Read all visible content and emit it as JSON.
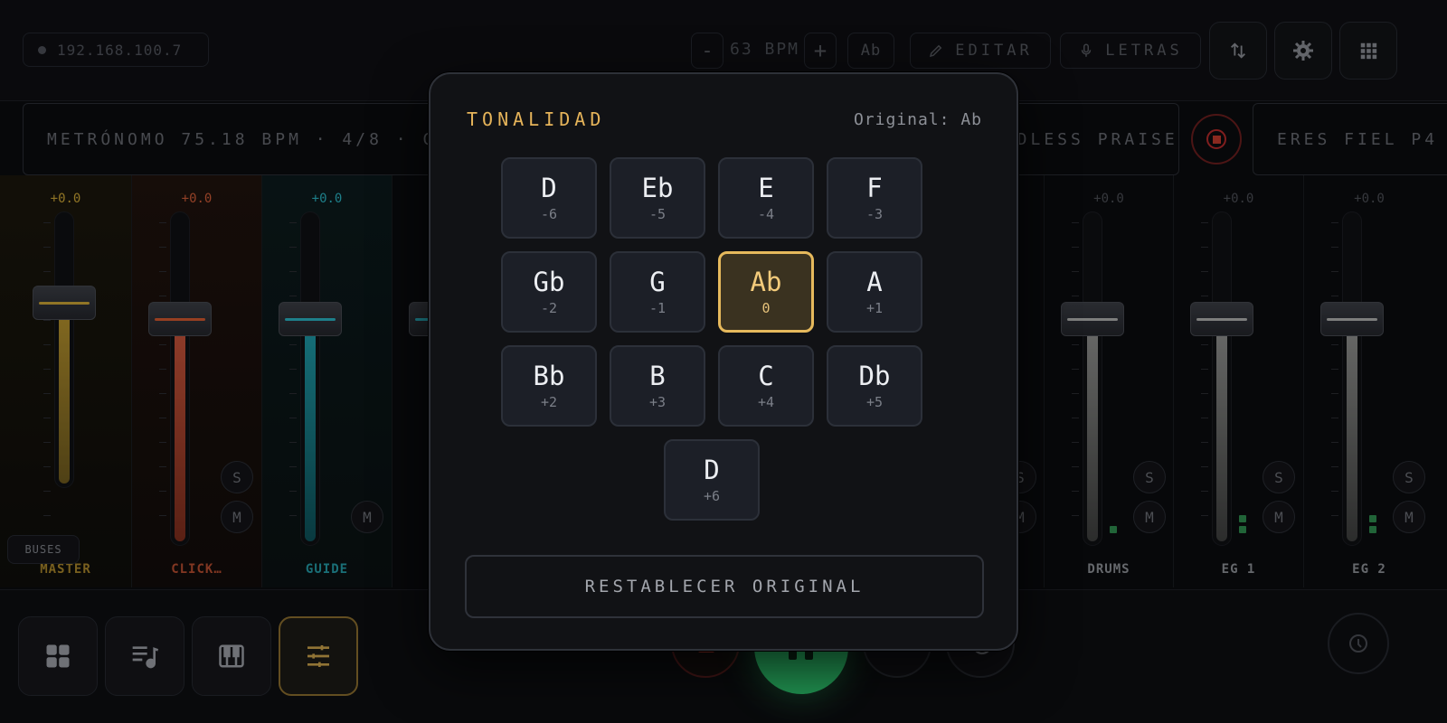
{
  "topbar": {
    "ip": "192.168.100.7",
    "bpm_minus": "-",
    "bpm_value": "63 BPM",
    "bpm_plus": "+",
    "key_button": "Ab",
    "edit_label": "EDITAR",
    "lyrics_label": "LETRAS"
  },
  "infobar": {
    "metronome": "METRÓNOMO 75.18 BPM · 4/8 · CL",
    "song_current": "ENDLESS PRAISE",
    "song_next": "ERES FIEL P4"
  },
  "channels": [
    {
      "db": "+0.0",
      "name": "MASTER",
      "color": "#c9a335"
    },
    {
      "db": "+0.0",
      "name": "CLICK…",
      "color": "#cc5a36"
    },
    {
      "db": "+0.0",
      "name": "GUIDE",
      "color": "#2ab0bf"
    },
    {
      "db": "+0.0",
      "name": "DRUMS",
      "color": "#b9bab8"
    },
    {
      "db": "+0.0",
      "name": "EG 1",
      "color": "#b9bab8"
    },
    {
      "db": "+0.0",
      "name": "EG 2",
      "color": "#b9bab8"
    }
  ],
  "channel_buttons": {
    "solo": "S",
    "mute": "M",
    "buses": "BUSES"
  },
  "modal": {
    "title": "TONALIDAD",
    "original": "Original: Ab",
    "keys": [
      {
        "key": "D",
        "offset": "-6"
      },
      {
        "key": "Eb",
        "offset": "-5"
      },
      {
        "key": "E",
        "offset": "-4"
      },
      {
        "key": "F",
        "offset": "-3"
      },
      {
        "key": "Gb",
        "offset": "-2"
      },
      {
        "key": "G",
        "offset": "-1"
      },
      {
        "key": "Ab",
        "offset": "0"
      },
      {
        "key": "A",
        "offset": "+1"
      },
      {
        "key": "Bb",
        "offset": "+2"
      },
      {
        "key": "B",
        "offset": "+3"
      },
      {
        "key": "C",
        "offset": "+4"
      },
      {
        "key": "Db",
        "offset": "+5"
      },
      {
        "key": "D",
        "offset": "+6"
      }
    ],
    "selected_key": "Ab",
    "reset_label": "RESTABLECER ORIGINAL"
  },
  "colors": {
    "accent": "#e6b95c",
    "play": "#2ecc71",
    "record": "#c0392b"
  }
}
